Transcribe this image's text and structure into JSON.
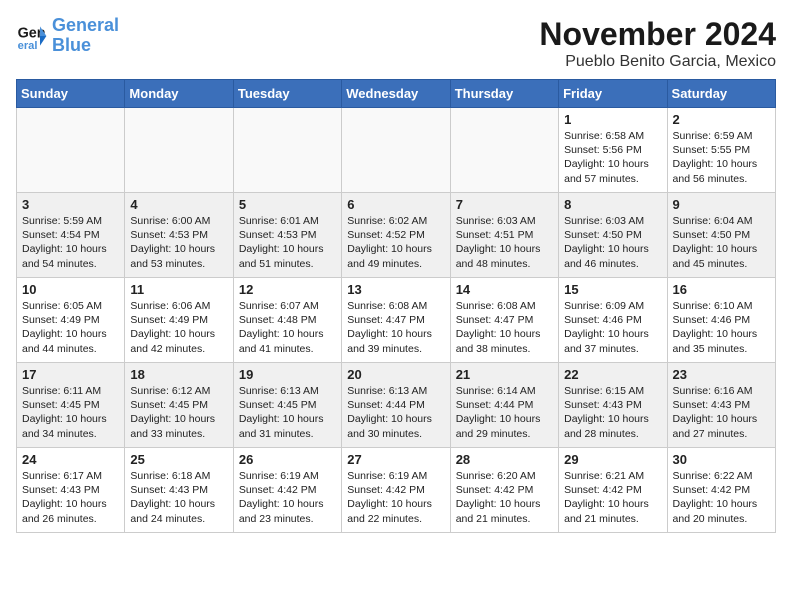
{
  "header": {
    "logo_line1": "General",
    "logo_line2": "Blue",
    "month": "November 2024",
    "location": "Pueblo Benito Garcia, Mexico"
  },
  "weekdays": [
    "Sunday",
    "Monday",
    "Tuesday",
    "Wednesday",
    "Thursday",
    "Friday",
    "Saturday"
  ],
  "weeks": [
    [
      {
        "day": "",
        "text": ""
      },
      {
        "day": "",
        "text": ""
      },
      {
        "day": "",
        "text": ""
      },
      {
        "day": "",
        "text": ""
      },
      {
        "day": "",
        "text": ""
      },
      {
        "day": "1",
        "text": "Sunrise: 6:58 AM\nSunset: 5:56 PM\nDaylight: 10 hours\nand 57 minutes."
      },
      {
        "day": "2",
        "text": "Sunrise: 6:59 AM\nSunset: 5:55 PM\nDaylight: 10 hours\nand 56 minutes."
      }
    ],
    [
      {
        "day": "3",
        "text": "Sunrise: 5:59 AM\nSunset: 4:54 PM\nDaylight: 10 hours\nand 54 minutes."
      },
      {
        "day": "4",
        "text": "Sunrise: 6:00 AM\nSunset: 4:53 PM\nDaylight: 10 hours\nand 53 minutes."
      },
      {
        "day": "5",
        "text": "Sunrise: 6:01 AM\nSunset: 4:53 PM\nDaylight: 10 hours\nand 51 minutes."
      },
      {
        "day": "6",
        "text": "Sunrise: 6:02 AM\nSunset: 4:52 PM\nDaylight: 10 hours\nand 49 minutes."
      },
      {
        "day": "7",
        "text": "Sunrise: 6:03 AM\nSunset: 4:51 PM\nDaylight: 10 hours\nand 48 minutes."
      },
      {
        "day": "8",
        "text": "Sunrise: 6:03 AM\nSunset: 4:50 PM\nDaylight: 10 hours\nand 46 minutes."
      },
      {
        "day": "9",
        "text": "Sunrise: 6:04 AM\nSunset: 4:50 PM\nDaylight: 10 hours\nand 45 minutes."
      }
    ],
    [
      {
        "day": "10",
        "text": "Sunrise: 6:05 AM\nSunset: 4:49 PM\nDaylight: 10 hours\nand 44 minutes."
      },
      {
        "day": "11",
        "text": "Sunrise: 6:06 AM\nSunset: 4:49 PM\nDaylight: 10 hours\nand 42 minutes."
      },
      {
        "day": "12",
        "text": "Sunrise: 6:07 AM\nSunset: 4:48 PM\nDaylight: 10 hours\nand 41 minutes."
      },
      {
        "day": "13",
        "text": "Sunrise: 6:08 AM\nSunset: 4:47 PM\nDaylight: 10 hours\nand 39 minutes."
      },
      {
        "day": "14",
        "text": "Sunrise: 6:08 AM\nSunset: 4:47 PM\nDaylight: 10 hours\nand 38 minutes."
      },
      {
        "day": "15",
        "text": "Sunrise: 6:09 AM\nSunset: 4:46 PM\nDaylight: 10 hours\nand 37 minutes."
      },
      {
        "day": "16",
        "text": "Sunrise: 6:10 AM\nSunset: 4:46 PM\nDaylight: 10 hours\nand 35 minutes."
      }
    ],
    [
      {
        "day": "17",
        "text": "Sunrise: 6:11 AM\nSunset: 4:45 PM\nDaylight: 10 hours\nand 34 minutes."
      },
      {
        "day": "18",
        "text": "Sunrise: 6:12 AM\nSunset: 4:45 PM\nDaylight: 10 hours\nand 33 minutes."
      },
      {
        "day": "19",
        "text": "Sunrise: 6:13 AM\nSunset: 4:45 PM\nDaylight: 10 hours\nand 31 minutes."
      },
      {
        "day": "20",
        "text": "Sunrise: 6:13 AM\nSunset: 4:44 PM\nDaylight: 10 hours\nand 30 minutes."
      },
      {
        "day": "21",
        "text": "Sunrise: 6:14 AM\nSunset: 4:44 PM\nDaylight: 10 hours\nand 29 minutes."
      },
      {
        "day": "22",
        "text": "Sunrise: 6:15 AM\nSunset: 4:43 PM\nDaylight: 10 hours\nand 28 minutes."
      },
      {
        "day": "23",
        "text": "Sunrise: 6:16 AM\nSunset: 4:43 PM\nDaylight: 10 hours\nand 27 minutes."
      }
    ],
    [
      {
        "day": "24",
        "text": "Sunrise: 6:17 AM\nSunset: 4:43 PM\nDaylight: 10 hours\nand 26 minutes."
      },
      {
        "day": "25",
        "text": "Sunrise: 6:18 AM\nSunset: 4:43 PM\nDaylight: 10 hours\nand 24 minutes."
      },
      {
        "day": "26",
        "text": "Sunrise: 6:19 AM\nSunset: 4:42 PM\nDaylight: 10 hours\nand 23 minutes."
      },
      {
        "day": "27",
        "text": "Sunrise: 6:19 AM\nSunset: 4:42 PM\nDaylight: 10 hours\nand 22 minutes."
      },
      {
        "day": "28",
        "text": "Sunrise: 6:20 AM\nSunset: 4:42 PM\nDaylight: 10 hours\nand 21 minutes."
      },
      {
        "day": "29",
        "text": "Sunrise: 6:21 AM\nSunset: 4:42 PM\nDaylight: 10 hours\nand 21 minutes."
      },
      {
        "day": "30",
        "text": "Sunrise: 6:22 AM\nSunset: 4:42 PM\nDaylight: 10 hours\nand 20 minutes."
      }
    ]
  ]
}
